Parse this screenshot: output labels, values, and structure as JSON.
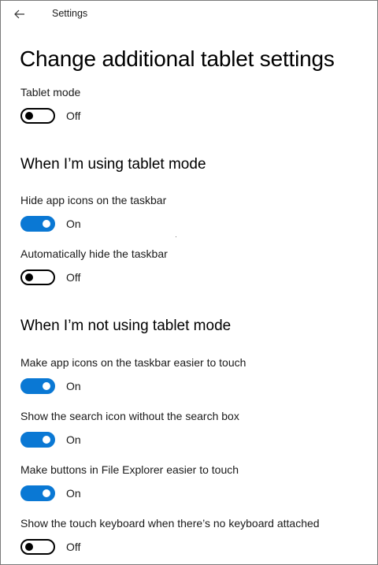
{
  "window": {
    "app_title": "Settings",
    "back_icon": "arrow-left-icon"
  },
  "page": {
    "title": "Change additional tablet settings"
  },
  "tablet_mode": {
    "label": "Tablet mode",
    "state": "Off",
    "on": false
  },
  "section_using": {
    "header": "When I’m using tablet mode",
    "hide_icons": {
      "label": "Hide app icons on the taskbar",
      "state": "On",
      "on": true
    },
    "auto_hide": {
      "label": "Automatically hide the taskbar",
      "state": "Off",
      "on": false
    }
  },
  "section_not_using": {
    "header": "When I’m not using tablet mode",
    "easier_icons": {
      "label": "Make app icons on the taskbar easier to touch",
      "state": "On",
      "on": true
    },
    "search_icon": {
      "label": "Show the search icon without the search box",
      "state": "On",
      "on": true
    },
    "file_explorer": {
      "label": "Make buttons in File Explorer easier to touch",
      "state": "On",
      "on": true
    },
    "touch_keyboard": {
      "label": "Show the touch keyboard when there’s no keyboard attached",
      "state": "Off",
      "on": false
    }
  },
  "colors": {
    "accent": "#0a78d4",
    "toggle_off_border": "#000000",
    "background": "#ffffff"
  }
}
